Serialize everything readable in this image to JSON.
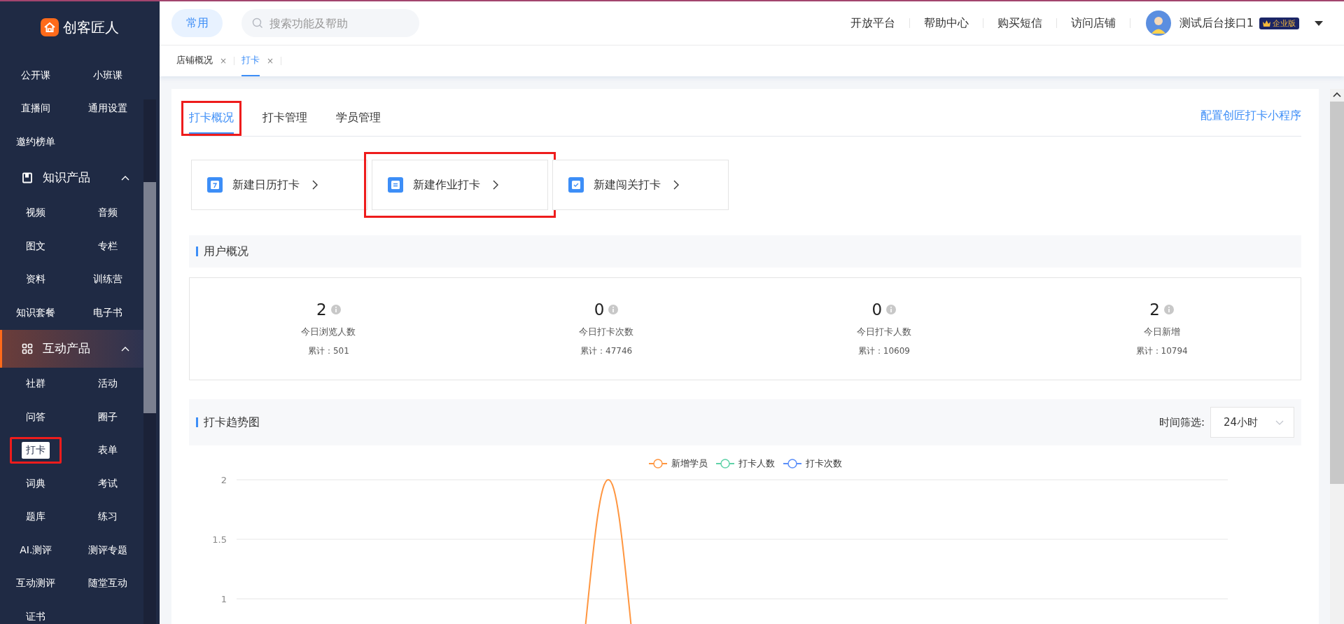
{
  "logo": {
    "text": "创客匠人"
  },
  "sidebar": {
    "groups": [
      {
        "items": [
          {
            "label": "公开课",
            "selected": false,
            "highlighted": false
          },
          {
            "label": "小班课",
            "selected": false,
            "highlighted": false
          },
          {
            "label": "直播间",
            "selected": false,
            "highlighted": false
          },
          {
            "label": "通用设置",
            "selected": false,
            "highlighted": false
          },
          {
            "label": "邀约榜单",
            "selected": false,
            "highlighted": false
          }
        ]
      },
      {
        "label": "知识产品",
        "expanded": true,
        "active": false,
        "items": [
          {
            "label": "视频",
            "selected": false,
            "highlighted": false
          },
          {
            "label": "音频",
            "selected": false,
            "highlighted": false
          },
          {
            "label": "图文",
            "selected": false,
            "highlighted": false
          },
          {
            "label": "专栏",
            "selected": false,
            "highlighted": false
          },
          {
            "label": "资料",
            "selected": false,
            "highlighted": false
          },
          {
            "label": "训练营",
            "selected": false,
            "highlighted": false
          },
          {
            "label": "知识套餐",
            "selected": false,
            "highlighted": false
          },
          {
            "label": "电子书",
            "selected": false,
            "highlighted": false
          }
        ]
      },
      {
        "label": "互动产品",
        "expanded": true,
        "active": true,
        "items": [
          {
            "label": "社群",
            "selected": false,
            "highlighted": false
          },
          {
            "label": "活动",
            "selected": false,
            "highlighted": false
          },
          {
            "label": "问答",
            "selected": false,
            "highlighted": false
          },
          {
            "label": "圈子",
            "selected": false,
            "highlighted": false
          },
          {
            "label": "打卡",
            "selected": true,
            "highlighted": true
          },
          {
            "label": "表单",
            "selected": false,
            "highlighted": false
          },
          {
            "label": "词典",
            "selected": false,
            "highlighted": false
          },
          {
            "label": "考试",
            "selected": false,
            "highlighted": false
          },
          {
            "label": "题库",
            "selected": false,
            "highlighted": false
          },
          {
            "label": "练习",
            "selected": false,
            "highlighted": false
          },
          {
            "label": "AI.测评",
            "selected": false,
            "highlighted": false
          },
          {
            "label": "测评专题",
            "selected": false,
            "highlighted": false
          },
          {
            "label": "互动测评",
            "selected": false,
            "highlighted": false
          },
          {
            "label": "随堂互动",
            "selected": false,
            "highlighted": false
          },
          {
            "label": "证书",
            "selected": false,
            "highlighted": false
          }
        ]
      }
    ]
  },
  "topbar": {
    "common_button": "常用",
    "search": {
      "placeholder": "搜索功能及帮助"
    },
    "links": [
      "开放平台",
      "帮助中心",
      "购买短信",
      "访问店铺"
    ],
    "user": {
      "name": "测试后台接口1",
      "badge": "企业版"
    }
  },
  "page_tabs": [
    {
      "label": "店铺概况",
      "selected": false,
      "close": "×"
    },
    {
      "label": "打卡",
      "selected": true,
      "close": "×"
    }
  ],
  "tabs": [
    {
      "label": "打卡概况",
      "selected": true,
      "highlighted": true
    },
    {
      "label": "打卡管理",
      "selected": false,
      "highlighted": false
    },
    {
      "label": "学员管理",
      "selected": false,
      "highlighted": false
    }
  ],
  "config_link": "配置创匠打卡小程序",
  "create_buttons": [
    {
      "label": "新建日历打卡",
      "kind": "calendar",
      "highlighted": false
    },
    {
      "label": "新建作业打卡",
      "kind": "homework",
      "highlighted": true
    },
    {
      "label": "新建闯关打卡",
      "kind": "challenge",
      "highlighted": false
    }
  ],
  "user_overview": {
    "title": "用户概况",
    "stats": [
      {
        "value": "2",
        "label": "今日浏览人数",
        "total": "累计：501"
      },
      {
        "value": "0",
        "label": "今日打卡次数",
        "total": "累计：47746"
      },
      {
        "value": "0",
        "label": "今日打卡人数",
        "total": "累计：10609"
      },
      {
        "value": "2",
        "label": "今日新增",
        "total": "累计：10794"
      }
    ]
  },
  "trend": {
    "title": "打卡趋势图",
    "filter_label": "时间筛选:",
    "filter_value": "24小时",
    "legend": [
      {
        "name": "新增学员",
        "color": "#ff9640"
      },
      {
        "name": "打卡人数",
        "color": "#5fd2a8"
      },
      {
        "name": "打卡次数",
        "color": "#5b8ff9"
      }
    ],
    "y_axis_labels": [
      "2",
      "1.5",
      "1"
    ]
  }
}
